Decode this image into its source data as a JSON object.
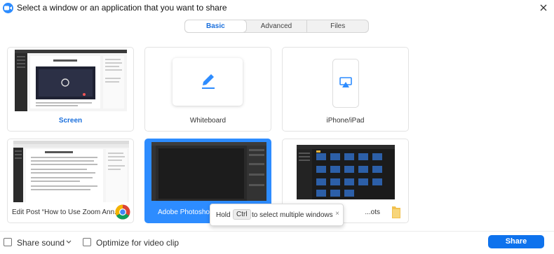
{
  "window": {
    "title": "Select a window or an application that you want to share"
  },
  "tabs": [
    {
      "label": "Basic",
      "active": true
    },
    {
      "label": "Advanced",
      "active": false
    },
    {
      "label": "Files",
      "active": false
    }
  ],
  "cards": [
    {
      "label": "Screen",
      "kind": "screen",
      "icon": "monitor-thumbnail"
    },
    {
      "label": "Whiteboard",
      "kind": "whiteboard",
      "icon": "pen-icon"
    },
    {
      "label": "iPhone/iPad",
      "kind": "device",
      "icon": "airplay-icon"
    },
    {
      "label": "Edit Post “How to Use Zoom Ann...",
      "kind": "window",
      "icon": "chrome-icon"
    },
    {
      "label": "Adobe Photoshop",
      "kind": "window",
      "selected": true
    },
    {
      "label": "...ots",
      "kind": "window",
      "icon": "folder-icon"
    }
  ],
  "tooltip": {
    "text_before": "Hold",
    "key": "Ctrl",
    "text_after": "to select multiple windows",
    "close": "×"
  },
  "options": {
    "share_sound": "Share sound",
    "optimize": "Optimize for video clip"
  },
  "share_button": "Share",
  "colors": {
    "accent": "#0e72ed",
    "selected_card": "#2d8cff"
  }
}
